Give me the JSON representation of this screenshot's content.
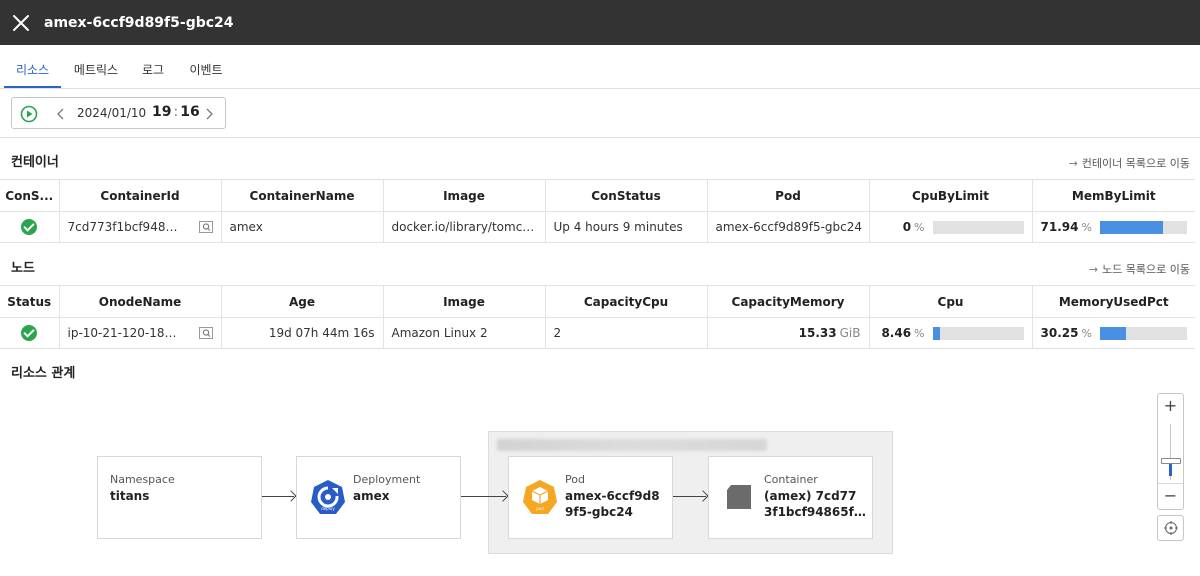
{
  "header": {
    "title": "amex-6ccf9d89f5-gbc24"
  },
  "tabs": [
    {
      "label": "리소스",
      "active": true
    },
    {
      "label": "메트릭스",
      "active": false
    },
    {
      "label": "로그",
      "active": false
    },
    {
      "label": "이벤트",
      "active": false
    }
  ],
  "timebar": {
    "date": "2024/01/10",
    "hour": "19",
    "minute": "16"
  },
  "containers": {
    "title": "컨테이너",
    "link": "컨테이너 목록으로 이동",
    "columns": [
      "ConS...",
      "ContainerId",
      "ContainerName",
      "Image",
      "ConStatus",
      "Pod",
      "CpuByLimit",
      "MemByLimit"
    ],
    "rows": [
      {
        "container_id": "7cd773f1bcf948…",
        "name": "amex",
        "image": "docker.io/library/tomc…",
        "status": "Up 4 hours 9 minutes",
        "pod": "amex-6ccf9d89f5-gbc24",
        "cpu": "0",
        "cpu_pct": 0,
        "mem": "71.94",
        "mem_pct": 71.94,
        "unit": "%"
      }
    ]
  },
  "nodes": {
    "title": "노드",
    "link": "노드 목록으로 이동",
    "columns": [
      "Status",
      "OnodeName",
      "Age",
      "Image",
      "CapacityCpu",
      "CapacityMemory",
      "Cpu",
      "MemoryUsedPct"
    ],
    "rows": [
      {
        "name": "ip-10-21-120-186…",
        "age": "19d 07h 44m 16s",
        "image": "Amazon Linux 2",
        "capacity_cpu": "2",
        "capacity_mem": "15.33",
        "capacity_mem_unit": "GiB",
        "cpu": "8.46",
        "cpu_pct": 8.46,
        "mem": "30.25",
        "mem_pct": 30.25,
        "unit": "%"
      }
    ]
  },
  "relations": {
    "title": "리소스 관계",
    "nodes": [
      {
        "type": "Namespace",
        "name": "titans"
      },
      {
        "type": "Deployment",
        "name": "amex"
      },
      {
        "type": "Pod",
        "name_line1": "amex-6ccf9d8",
        "name_line2": "9f5-gbc24"
      },
      {
        "type": "Container",
        "name_line1": "(amex) 7cd77",
        "name_line2": "3f1bcf94865f…"
      }
    ]
  },
  "colors": {
    "accent": "#2d62c9",
    "ok": "#2aa44f",
    "bar": "#4a90e2",
    "deploy": "#2a5cc9",
    "pod": "#f5a623"
  },
  "icons": [
    "close-icon",
    "play-icon",
    "chevron-left-icon",
    "chevron-right-icon",
    "arrow-right-icon",
    "check-icon",
    "magnify-icon",
    "deployment-icon",
    "pod-icon",
    "container-icon",
    "zoom-in-icon",
    "zoom-out-icon",
    "center-icon"
  ]
}
